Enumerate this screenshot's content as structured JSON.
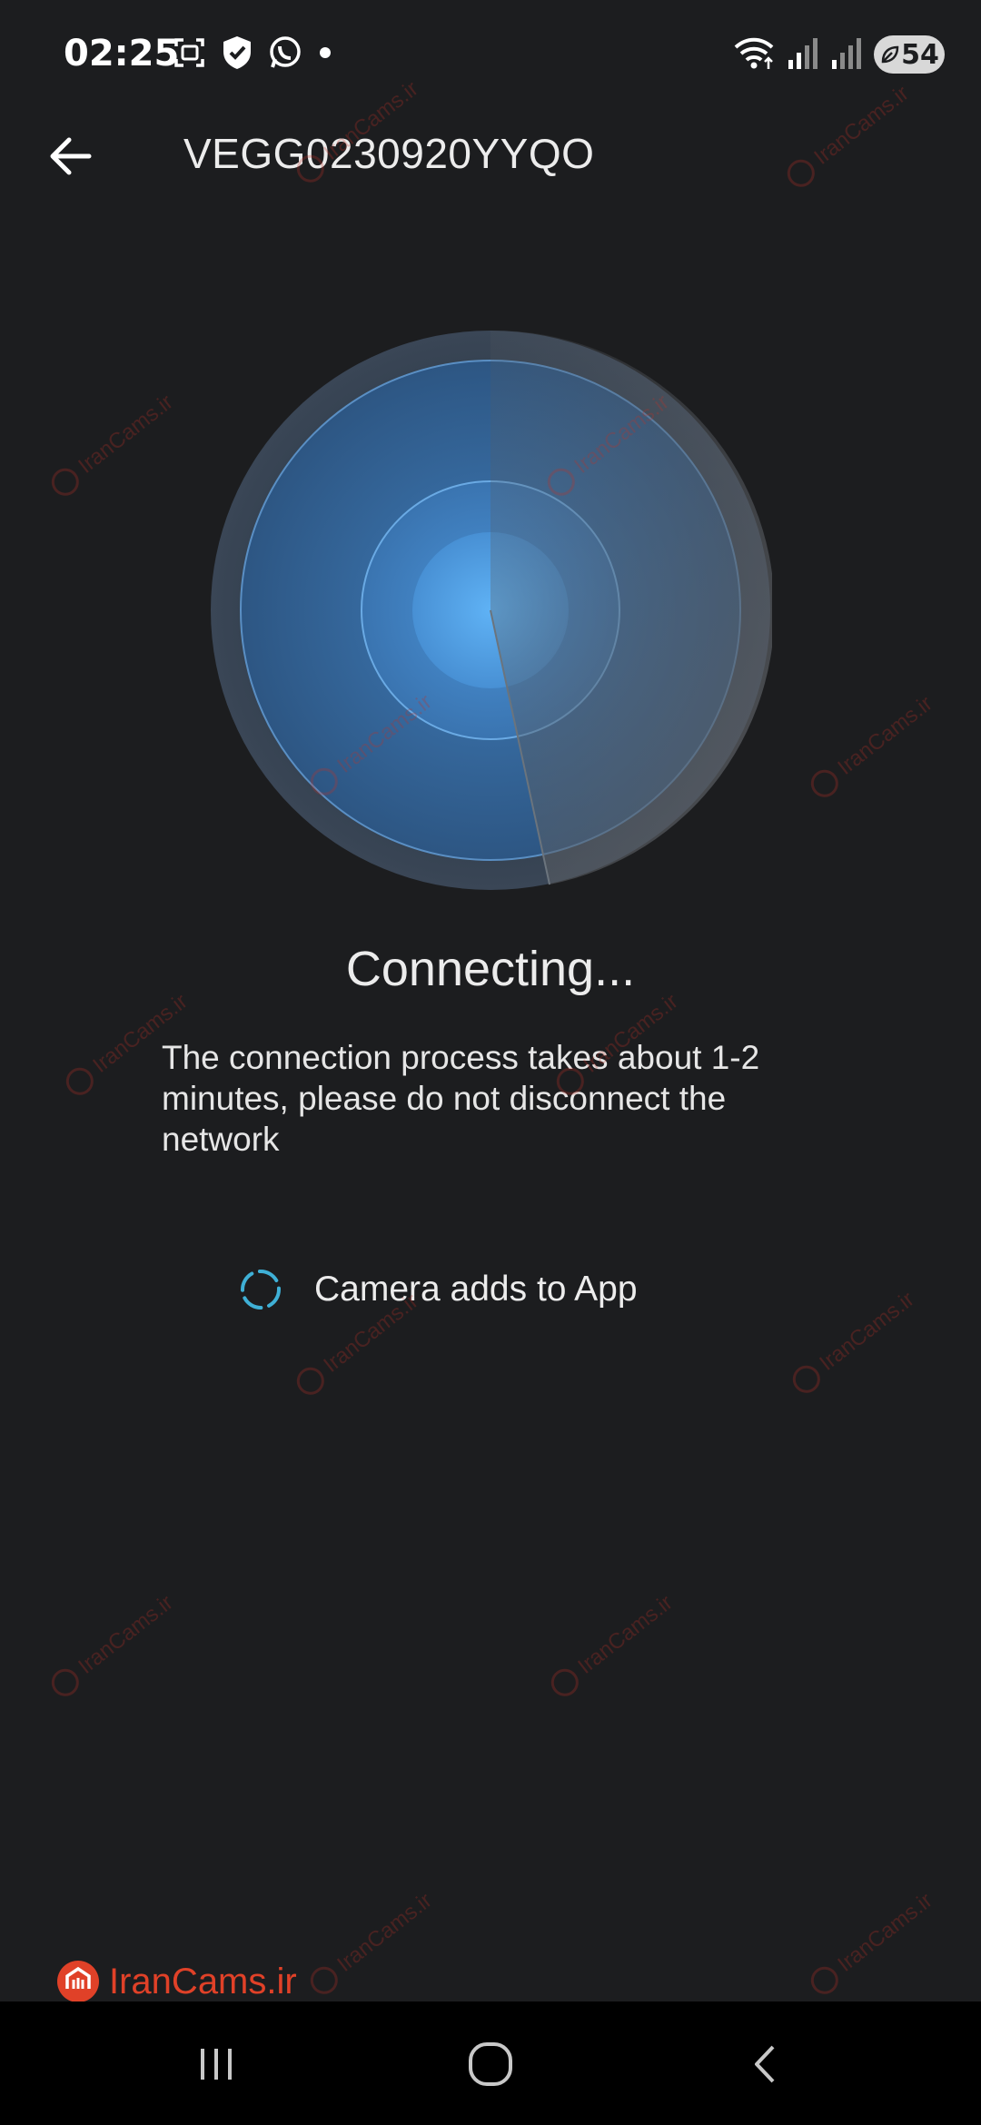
{
  "status_bar": {
    "time": "02:25",
    "battery_level": "54",
    "left_icons": [
      "screenshot-icon",
      "shield-check-icon",
      "whatsapp-icon",
      "notification-dot-icon"
    ],
    "right_icons": [
      "wifi-icon",
      "signal-icon",
      "signal-icon",
      "battery-icon"
    ]
  },
  "header": {
    "title": "VEGG0230920YYQO",
    "back_icon": "arrow-left-icon"
  },
  "main": {
    "radar_colors": {
      "outer_ring": "#3a4656",
      "disc": "#2f5c8a",
      "center": "#4ea3ea",
      "sweep_trail": "#5a5e63"
    },
    "status_title": "Connecting...",
    "status_description": "The connection process takes about 1-2 minutes, please do not disconnect the network",
    "steps": [
      {
        "label": "Camera adds to App",
        "state": "loading"
      }
    ]
  },
  "watermark": {
    "text": "IranCams.ir",
    "color": "#e04128"
  },
  "nav_bar": {
    "buttons": [
      "recent-apps-icon",
      "home-icon",
      "back-icon"
    ]
  }
}
